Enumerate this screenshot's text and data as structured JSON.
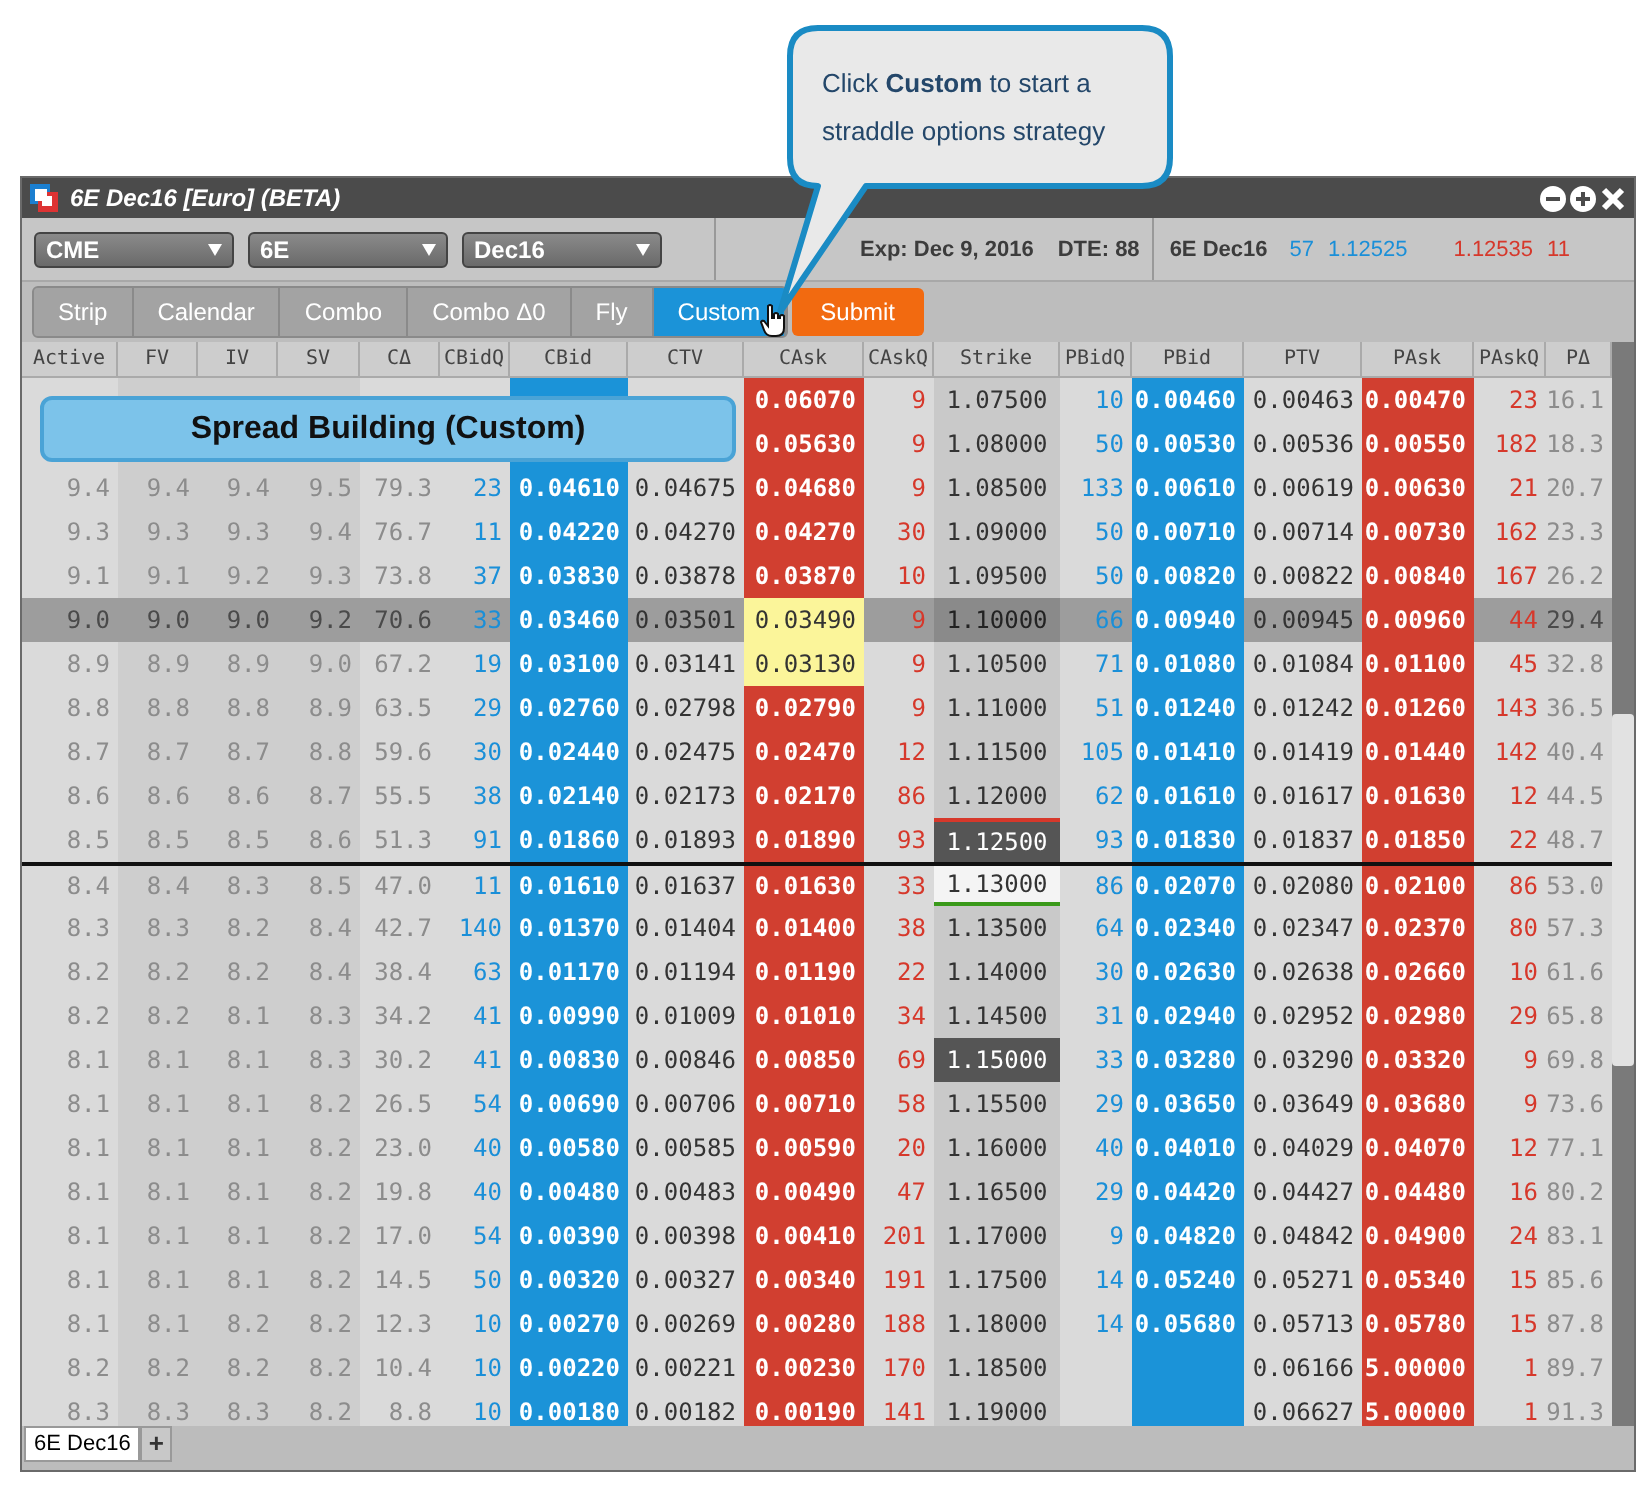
{
  "window": {
    "title": "6E Dec16 [Euro] (BETA)"
  },
  "selectors": [
    {
      "label": "CME"
    },
    {
      "label": "6E"
    },
    {
      "label": "Dec16"
    }
  ],
  "expiry": "Exp: Dec 9, 2016",
  "dte": "DTE: 88",
  "quote": {
    "symbol": "6E Dec16",
    "bid_qty": "57",
    "bid": "1.12525",
    "ask": "1.12535",
    "ask_qty": "11"
  },
  "strategies": [
    {
      "label": "Strip",
      "selected": false
    },
    {
      "label": "Calendar",
      "selected": false
    },
    {
      "label": "Combo",
      "selected": false
    },
    {
      "label": "Combo Δ0",
      "selected": false
    },
    {
      "label": "Fly",
      "selected": false
    },
    {
      "label": "Custom",
      "selected": true
    }
  ],
  "submit": "Submit",
  "callout": "Click **Custom** to start a straddle options strategy",
  "overlay": "Spread Building (Custom)",
  "table": {
    "columns": [
      {
        "label": "Active",
        "kind": "faint"
      },
      {
        "label": "FV",
        "kind": "faint-dark"
      },
      {
        "label": "IV",
        "kind": "faint-dark"
      },
      {
        "label": "SV",
        "kind": "faint-dark"
      },
      {
        "label": "CΔ",
        "kind": "faint"
      },
      {
        "label": "CBidQ",
        "kind": "bid-qty"
      },
      {
        "label": "CBid",
        "kind": "bid"
      },
      {
        "label": "CTV",
        "kind": "value"
      },
      {
        "label": "CAsk",
        "kind": "ask"
      },
      {
        "label": "CAskQ",
        "kind": "ask-qty"
      },
      {
        "label": "Strike",
        "kind": "strike"
      },
      {
        "label": "PBidQ",
        "kind": "bid-qty"
      },
      {
        "label": "PBid",
        "kind": "bid"
      },
      {
        "label": "PTV",
        "kind": "value"
      },
      {
        "label": "PAsk",
        "kind": "ask"
      },
      {
        "label": "PAskQ",
        "kind": "ask-qty"
      },
      {
        "label": "PΔ",
        "kind": "faint"
      }
    ],
    "rows": [
      {
        "cells": [
          "0.06070",
          "9",
          "1.07500",
          "10",
          "0.00460",
          "0.00463",
          "0.00470",
          "23",
          "16.1"
        ],
        "highlighted": false,
        "selected": false,
        "kind": "plain",
        "line_above": false
      },
      {
        "cells": [
          "0.05630",
          "9",
          "1.08000",
          "50",
          "0.00530",
          "0.00536",
          "0.00550",
          "182",
          "18.3"
        ],
        "highlighted": false,
        "selected": false,
        "kind": "plain",
        "line_above": false
      },
      {
        "cells": [
          "9.4",
          "9.4",
          "9.4",
          "9.5",
          "79.3",
          "23",
          "0.04610",
          "0.04675",
          "0.04680",
          "9",
          "1.08500",
          "133",
          "0.00610",
          "0.00619",
          "0.00630",
          "21",
          "20.7"
        ],
        "highlighted": false,
        "selected": false,
        "kind": "plain",
        "line_above": false
      },
      {
        "cells": [
          "9.3",
          "9.3",
          "9.3",
          "9.4",
          "76.7",
          "11",
          "0.04220",
          "0.04270",
          "0.04270",
          "30",
          "1.09000",
          "50",
          "0.00710",
          "0.00714",
          "0.00730",
          "162",
          "23.3"
        ],
        "highlighted": false,
        "selected": false,
        "kind": "plain",
        "line_above": false
      },
      {
        "cells": [
          "9.1",
          "9.1",
          "9.2",
          "9.3",
          "73.8",
          "37",
          "0.03830",
          "0.03878",
          "0.03870",
          "10",
          "1.09500",
          "50",
          "0.00820",
          "0.00822",
          "0.00840",
          "167",
          "26.2"
        ],
        "highlighted": false,
        "selected": false,
        "kind": "plain",
        "line_above": false
      },
      {
        "cells": [
          "9.0",
          "9.0",
          "9.0",
          "9.2",
          "70.6",
          "33",
          "0.03460",
          "0.03501",
          "0.03490",
          "9",
          "1.10000",
          "66",
          "0.00940",
          "0.00945",
          "0.00960",
          "44",
          "29.4"
        ],
        "highlighted": true,
        "selected": true,
        "kind": "plain",
        "line_above": false
      },
      {
        "cells": [
          "8.9",
          "8.9",
          "8.9",
          "9.0",
          "67.2",
          "19",
          "0.03100",
          "0.03141",
          "0.03130",
          "9",
          "1.10500",
          "71",
          "0.01080",
          "0.01084",
          "0.01100",
          "45",
          "32.8"
        ],
        "highlighted": false,
        "selected": true,
        "kind": "plain",
        "line_above": false
      },
      {
        "cells": [
          "8.8",
          "8.8",
          "8.8",
          "8.9",
          "63.5",
          "29",
          "0.02760",
          "0.02798",
          "0.02790",
          "9",
          "1.11000",
          "51",
          "0.01240",
          "0.01242",
          "0.01260",
          "143",
          "36.5"
        ],
        "highlighted": false,
        "selected": false,
        "kind": "plain",
        "line_above": false
      },
      {
        "cells": [
          "8.7",
          "8.7",
          "8.7",
          "8.8",
          "59.6",
          "30",
          "0.02440",
          "0.02475",
          "0.02470",
          "12",
          "1.11500",
          "105",
          "0.01410",
          "0.01419",
          "0.01440",
          "142",
          "40.4"
        ],
        "highlighted": false,
        "selected": false,
        "kind": "plain",
        "line_above": false
      },
      {
        "cells": [
          "8.6",
          "8.6",
          "8.6",
          "8.7",
          "55.5",
          "38",
          "0.02140",
          "0.02173",
          "0.02170",
          "86",
          "1.12000",
          "62",
          "0.01610",
          "0.01617",
          "0.01630",
          "12",
          "44.5"
        ],
        "highlighted": false,
        "selected": false,
        "kind": "plain",
        "line_above": false
      },
      {
        "cells": [
          "8.5",
          "8.5",
          "8.5",
          "8.6",
          "51.3",
          "91",
          "0.01860",
          "0.01893",
          "0.01890",
          "93",
          "1.12500",
          "93",
          "0.01830",
          "0.01837",
          "0.01850",
          "22",
          "48.7"
        ],
        "highlighted": false,
        "selected": false,
        "kind": "red-edge",
        "line_above": false
      },
      {
        "cells": [
          "8.4",
          "8.4",
          "8.3",
          "8.5",
          "47.0",
          "11",
          "0.01610",
          "0.01637",
          "0.01630",
          "33",
          "1.13000",
          "86",
          "0.02070",
          "0.02080",
          "0.02100",
          "86",
          "53.0"
        ],
        "highlighted": false,
        "selected": false,
        "kind": "green-edge",
        "line_above": true
      },
      {
        "cells": [
          "8.3",
          "8.3",
          "8.2",
          "8.4",
          "42.7",
          "140",
          "0.01370",
          "0.01404",
          "0.01400",
          "38",
          "1.13500",
          "64",
          "0.02340",
          "0.02347",
          "0.02370",
          "80",
          "57.3"
        ],
        "highlighted": false,
        "selected": false,
        "kind": "plain",
        "line_above": false
      },
      {
        "cells": [
          "8.2",
          "8.2",
          "8.2",
          "8.4",
          "38.4",
          "63",
          "0.01170",
          "0.01194",
          "0.01190",
          "22",
          "1.14000",
          "30",
          "0.02630",
          "0.02638",
          "0.02660",
          "10",
          "61.6"
        ],
        "highlighted": false,
        "selected": false,
        "kind": "plain",
        "line_above": false
      },
      {
        "cells": [
          "8.2",
          "8.2",
          "8.1",
          "8.3",
          "34.2",
          "41",
          "0.00990",
          "0.01009",
          "0.01010",
          "34",
          "1.14500",
          "31",
          "0.02940",
          "0.02952",
          "0.02980",
          "29",
          "65.8"
        ],
        "highlighted": false,
        "selected": false,
        "kind": "plain",
        "line_above": false
      },
      {
        "cells": [
          "8.1",
          "8.1",
          "8.1",
          "8.3",
          "30.2",
          "41",
          "0.00830",
          "0.00846",
          "0.00850",
          "69",
          "1.15000",
          "33",
          "0.03280",
          "0.03290",
          "0.03320",
          "9",
          "69.8"
        ],
        "highlighted": false,
        "selected": false,
        "kind": "dark",
        "line_above": false
      },
      {
        "cells": [
          "8.1",
          "8.1",
          "8.1",
          "8.2",
          "26.5",
          "54",
          "0.00690",
          "0.00706",
          "0.00710",
          "58",
          "1.15500",
          "29",
          "0.03650",
          "0.03649",
          "0.03680",
          "9",
          "73.6"
        ],
        "highlighted": false,
        "selected": false,
        "kind": "plain",
        "line_above": false
      },
      {
        "cells": [
          "8.1",
          "8.1",
          "8.1",
          "8.2",
          "23.0",
          "40",
          "0.00580",
          "0.00585",
          "0.00590",
          "20",
          "1.16000",
          "40",
          "0.04010",
          "0.04029",
          "0.04070",
          "12",
          "77.1"
        ],
        "highlighted": false,
        "selected": false,
        "kind": "plain",
        "line_above": false
      },
      {
        "cells": [
          "8.1",
          "8.1",
          "8.1",
          "8.2",
          "19.8",
          "40",
          "0.00480",
          "0.00483",
          "0.00490",
          "47",
          "1.16500",
          "29",
          "0.04420",
          "0.04427",
          "0.04480",
          "16",
          "80.2"
        ],
        "highlighted": false,
        "selected": false,
        "kind": "plain",
        "line_above": false
      },
      {
        "cells": [
          "8.1",
          "8.1",
          "8.1",
          "8.2",
          "17.0",
          "54",
          "0.00390",
          "0.00398",
          "0.00410",
          "201",
          "1.17000",
          "9",
          "0.04820",
          "0.04842",
          "0.04900",
          "24",
          "83.1"
        ],
        "highlighted": false,
        "selected": false,
        "kind": "plain",
        "line_above": false
      },
      {
        "cells": [
          "8.1",
          "8.1",
          "8.1",
          "8.2",
          "14.5",
          "50",
          "0.00320",
          "0.00327",
          "0.00340",
          "191",
          "1.17500",
          "14",
          "0.05240",
          "0.05271",
          "0.05340",
          "15",
          "85.6"
        ],
        "highlighted": false,
        "selected": false,
        "kind": "plain",
        "line_above": false
      },
      {
        "cells": [
          "8.1",
          "8.1",
          "8.2",
          "8.2",
          "12.3",
          "10",
          "0.00270",
          "0.00269",
          "0.00280",
          "188",
          "1.18000",
          "14",
          "0.05680",
          "0.05713",
          "0.05780",
          "15",
          "87.8"
        ],
        "highlighted": false,
        "selected": false,
        "kind": "plain",
        "line_above": false
      },
      {
        "cells": [
          "8.2",
          "8.2",
          "8.2",
          "8.2",
          "10.4",
          "10",
          "0.00220",
          "0.00221",
          "0.00230",
          "170",
          "1.18500",
          null,
          null,
          "0.06166",
          "5.00000",
          "1",
          "89.7"
        ],
        "highlighted": false,
        "selected": false,
        "kind": "plain",
        "line_above": false
      },
      {
        "cells": [
          "8.3",
          "8.3",
          "8.3",
          "8.2",
          "8.8",
          "10",
          "0.00180",
          "0.00182",
          "0.00190",
          "141",
          "1.19000",
          null,
          null,
          "0.06627",
          "5.00000",
          "1",
          "91.3"
        ],
        "highlighted": false,
        "selected": false,
        "kind": "plain",
        "line_above": false
      }
    ]
  },
  "sheet_tabs": [
    {
      "label": "6E Dec16",
      "selected": true
    }
  ],
  "add_tab": "+"
}
